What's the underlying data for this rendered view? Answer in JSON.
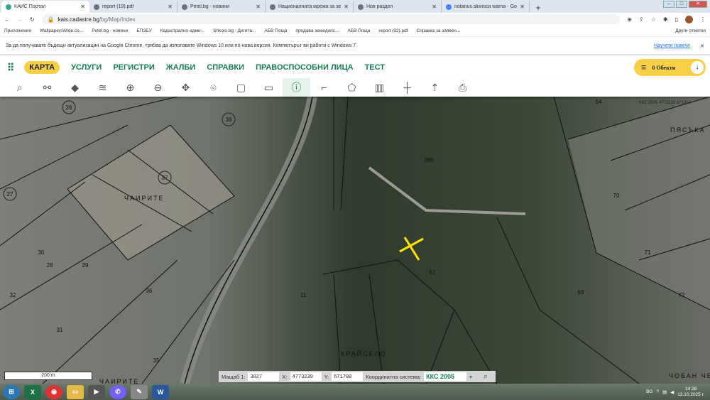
{
  "browser": {
    "tabs": [
      {
        "label": "КАИС Портал",
        "active": true
      },
      {
        "label": "report (19).pdf"
      },
      {
        "label": "Petel.bg - новини"
      },
      {
        "label": "Националната мрежа за земед..."
      },
      {
        "label": "Нов раздел"
      },
      {
        "label": "notarius sliwnica warna - Google..."
      }
    ],
    "url_host": "kais.cadastre.bg",
    "url_path": "/bg/Map/Index",
    "bookmarks": [
      "Приложения",
      "WallpapersWide.co...",
      "Petel.bg - новини",
      "ЕПЗЕУ",
      "Кадастрално-адми...",
      "Shkolo.bg : Дигита...",
      "АБВ Поща",
      "продава земеделс...",
      "АБВ Поща",
      "report (92).pdf",
      "Справка за заявен..."
    ],
    "other_bookmarks": "Други отметки",
    "infobar": "За да получавате бъдещи актуализации на Google Chrome, трябва да използвате Windows 10 или по-нова версия. Компютърът ви работи с Windows 7.",
    "learn_more": "Научете повече"
  },
  "nav": {
    "items": [
      "КАРТА",
      "УСЛУГИ",
      "РЕГИСТРИ",
      "ЖАЛБИ",
      "СПРАВКИ",
      "ПРАВОСПОСОБНИ ЛИЦА",
      "ТЕСТ"
    ],
    "objects": "0 Обекти"
  },
  "toolbar": [
    "search-icon",
    "connect-icon",
    "layer-icon",
    "layers-icon",
    "zoom-in-icon",
    "zoom-out-icon",
    "pan-icon",
    "pin-icon",
    "select-rect-icon",
    "deselect-rect-icon",
    "info-icon",
    "measure-icon",
    "polygon-icon",
    "map-icon",
    "crosshair-icon",
    "upload-icon",
    "print-icon"
  ],
  "map": {
    "parcels": [
      "26",
      "38",
      "37",
      "27",
      "28",
      "29",
      "30",
      "32",
      "36",
      "31",
      "35",
      "11",
      "52",
      "388",
      "70",
      "71",
      "72",
      "63",
      "64"
    ],
    "areas": [
      "ЧАИРИТЕ",
      "КРАЙСЕЛО",
      "ПЯСЪКА",
      "ЧАИРИТЕ",
      "ЧОБАН ЧЕШМ"
    ],
    "corner_coords": "ККС 2005 4773239 671914",
    "scale": "200 m"
  },
  "coords": {
    "scale_label": "Мащаб 1:",
    "scale": "3827",
    "x_label": "X:",
    "x": "4773239",
    "y_label": "Y:",
    "y": "671788",
    "system_label": "Координатна система:",
    "system": "ККС 2005"
  },
  "taskbar": {
    "lang": "BG",
    "time": "14:28",
    "date": "13.10.2025 г."
  }
}
